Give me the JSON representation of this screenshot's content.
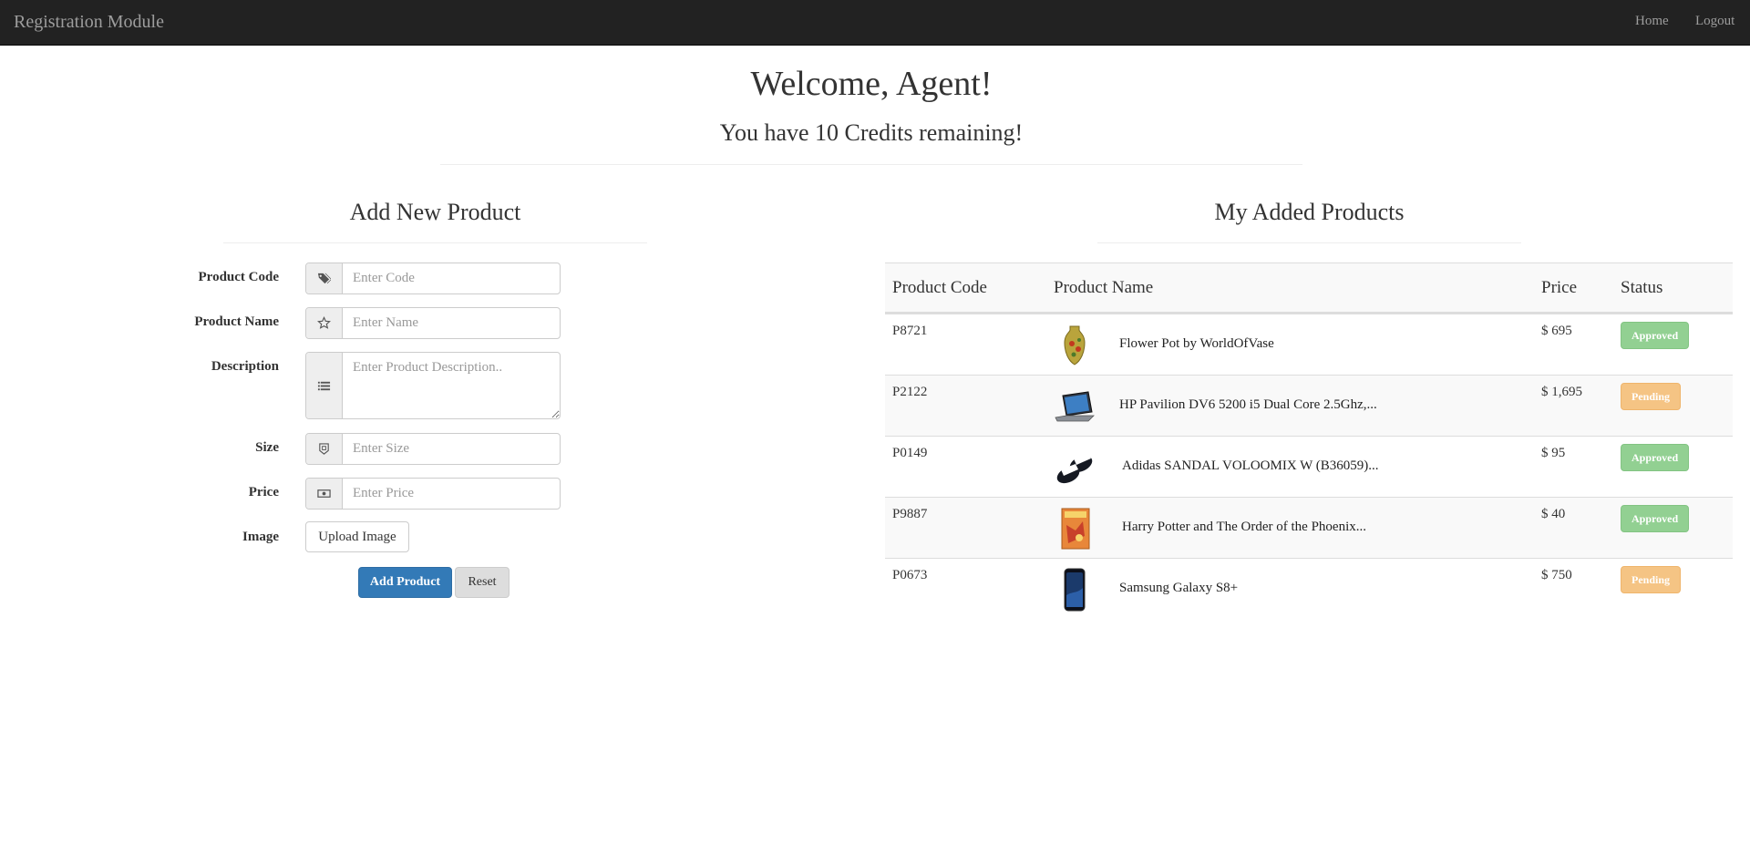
{
  "navbar": {
    "brand": "Registration Module",
    "links": [
      "Home",
      "Logout"
    ]
  },
  "header": {
    "welcome": "Welcome, Agent!",
    "credits": "You have 10 Credits remaining!"
  },
  "form": {
    "title": "Add New Product",
    "fields": [
      {
        "label": "Product Code",
        "placeholder": "Enter Code",
        "icon": "tags-icon"
      },
      {
        "label": "Product Name",
        "placeholder": "Enter Name",
        "icon": "star-icon"
      },
      {
        "label": "Description",
        "placeholder": "Enter Product Description..",
        "icon": "list-icon"
      },
      {
        "label": "Size",
        "placeholder": "Enter Size",
        "icon": "size-icon"
      },
      {
        "label": "Price",
        "placeholder": "Enter Price",
        "icon": "money-icon"
      }
    ],
    "image_label": "Image",
    "upload_label": "Upload Image",
    "add_label": "Add Product",
    "reset_label": "Reset"
  },
  "products": {
    "title": "My Added Products",
    "columns": [
      "Product Code",
      "Product Name",
      "Price",
      "Status"
    ],
    "rows": [
      {
        "code": "P8721",
        "name": "Flower Pot by WorldOfVase",
        "price": "$ 695",
        "status": "Approved",
        "thumb": "vase"
      },
      {
        "code": "P2122",
        "name": "HP Pavilion DV6 5200 i5 Dual Core 2.5Ghz,...",
        "price": "$ 1,695",
        "status": "Pending",
        "thumb": "laptop"
      },
      {
        "code": "P0149",
        "name": "Adidas SANDAL VOLOOMIX W (B36059)...",
        "price": "$ 95",
        "status": "Approved",
        "thumb": "sandal"
      },
      {
        "code": "P9887",
        "name": "Harry Potter and The Order of the Phoenix...",
        "price": "$ 40",
        "status": "Approved",
        "thumb": "book"
      },
      {
        "code": "P0673",
        "name": "Samsung Galaxy S8+",
        "price": "$ 750",
        "status": "Pending",
        "thumb": "phone"
      }
    ]
  },
  "colors": {
    "navbar_bg": "#222222",
    "primary": "#337ab7",
    "approved": "#92d092",
    "pending": "#f5c484"
  }
}
